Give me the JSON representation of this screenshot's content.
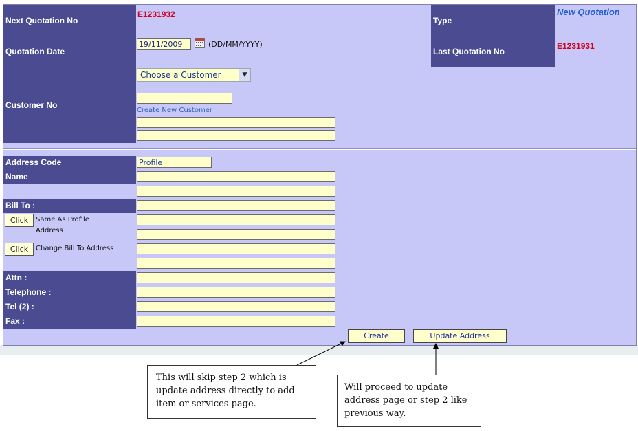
{
  "header": {
    "next_quotation_label": "Next Quotation No",
    "next_quotation_value": "E1231932",
    "type_label": "Type",
    "type_value": "New Quotation",
    "quotation_date_label": "Quotation Date",
    "quotation_date_value": "19/11/2009",
    "date_format_hint": "(DD/MM/YYYY)",
    "last_quotation_label": "Last Quotation No",
    "last_quotation_value": "E1231931",
    "customer_select_value": "Choose a Customer",
    "customer_no_label": "Customer No",
    "create_customer_link": "Create New Customer"
  },
  "address": {
    "address_code_label": "Address Code",
    "address_code_value": "Profile",
    "name_label": "Name",
    "bill_to_label": "Bill To :",
    "same_as_profile_button": "Click",
    "same_as_profile_text": "Same As Profile Address",
    "change_bill_button": "Click",
    "change_bill_text": "Change Bill To Address",
    "attn_label": "Attn :",
    "telephone_label": "Telephone :",
    "tel2_label": "Tel (2) :",
    "fax_label": "Fax :"
  },
  "actions": {
    "create_label": "Create",
    "update_address_label": "Update Address"
  },
  "callouts": {
    "create_note": "This will skip step 2 which is update address directly to add item or services page.",
    "update_note": "Will proceed to update address page or step 2 like previous way."
  },
  "colors": {
    "panel_bg": "#c8c8f8",
    "label_bg": "#4b4b91",
    "input_bg": "#ffffcc",
    "value_red": "#d00020",
    "type_blue": "#2060d0"
  }
}
